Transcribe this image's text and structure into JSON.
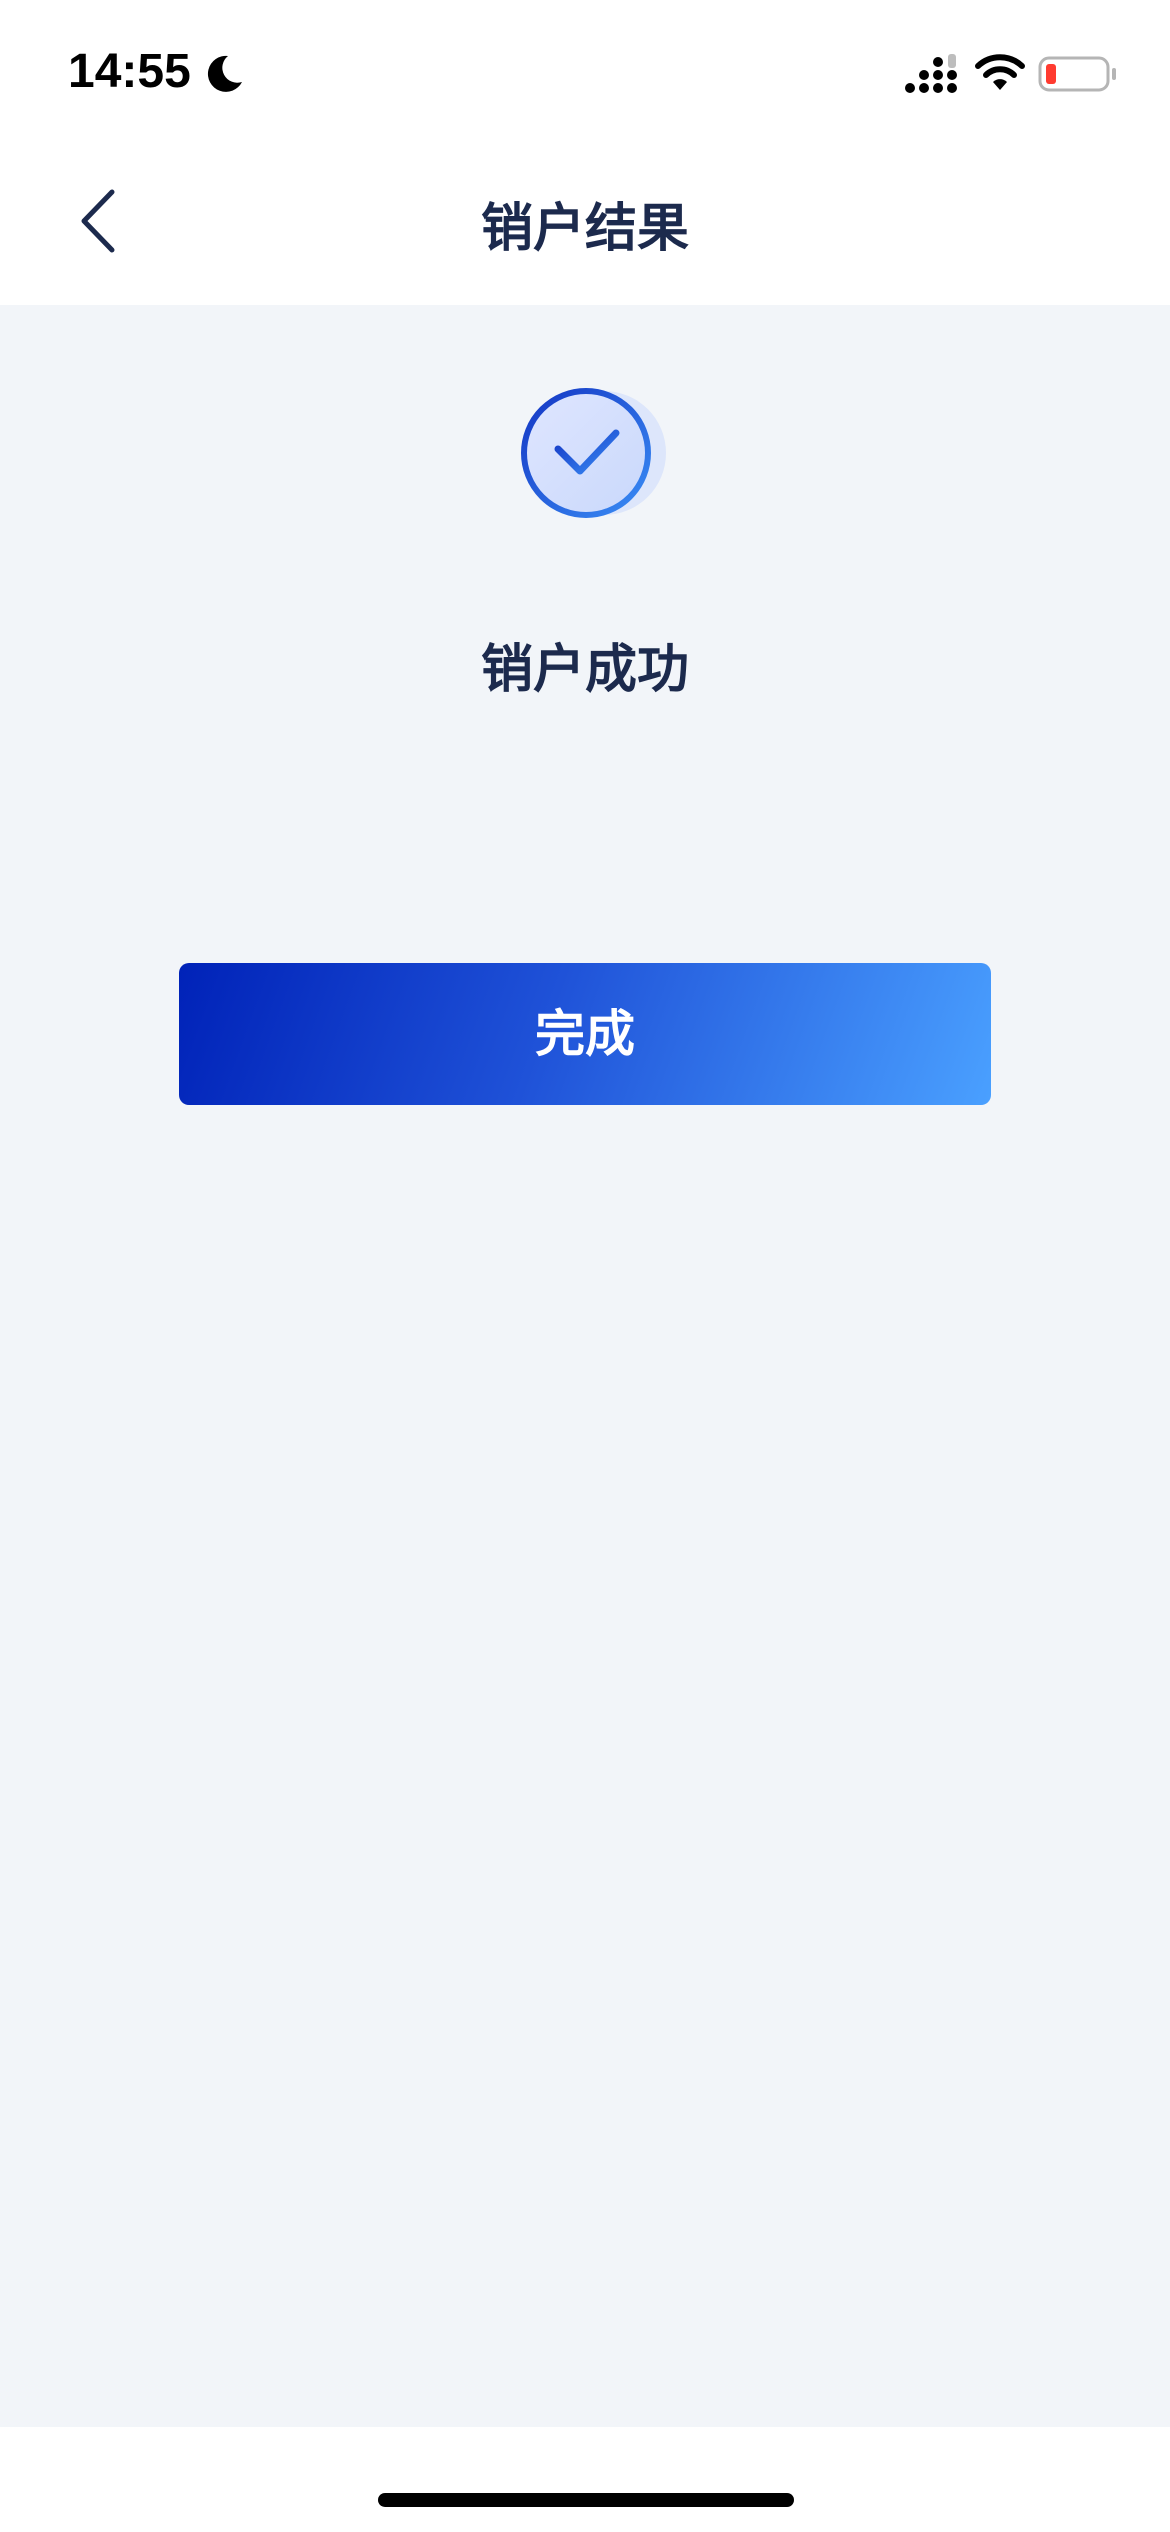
{
  "status_bar": {
    "time": "14:55",
    "icons": [
      "moon-icon",
      "signal-icon",
      "wifi-icon",
      "battery-icon"
    ],
    "battery_color": "#ff3b30"
  },
  "nav": {
    "title": "销户结果",
    "back_icon": "chevron-left-icon"
  },
  "result": {
    "icon": "check-circle-icon",
    "message": "销户成功"
  },
  "actions": {
    "done_label": "完成"
  },
  "colors": {
    "title_text": "#1c2a4d",
    "background": "#f2f5f9",
    "button_gradient_start": "#0022b8",
    "button_gradient_end": "#4aa0ff"
  }
}
